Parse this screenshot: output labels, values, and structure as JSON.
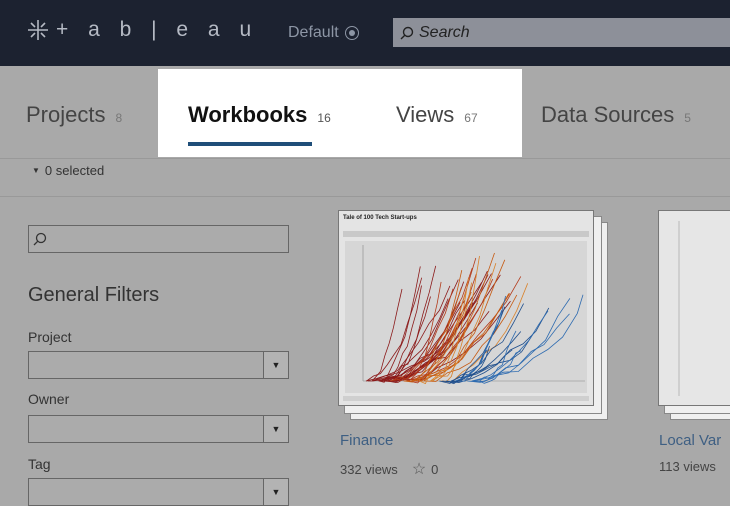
{
  "topbar": {
    "logo_text": "+ a b | e a u",
    "site_label": "Default",
    "search_placeholder": "Search",
    "icons": [
      "tableau-logo-icon",
      "site-selector-icon",
      "search-icon"
    ]
  },
  "tabs": [
    {
      "label": "Projects",
      "count": "8"
    },
    {
      "label": "Workbooks",
      "count": "16"
    },
    {
      "label": "Views",
      "count": "67"
    },
    {
      "label": "Data Sources",
      "count": "5"
    }
  ],
  "selection": {
    "label": "0 selected"
  },
  "sidebar": {
    "heading": "General Filters",
    "filters": [
      {
        "label": "Project"
      },
      {
        "label": "Owner"
      },
      {
        "label": "Tag"
      }
    ]
  },
  "cards": [
    {
      "name": "Finance",
      "views": "332 views",
      "favorites": "0",
      "thumb_title": "Tale of 100 Tech Start-ups"
    },
    {
      "name": "Local Var",
      "views": "113 views"
    }
  ],
  "colors": {
    "accent": "#1f4e79",
    "link": "#3e5f83",
    "topbar": "#1c2230"
  }
}
